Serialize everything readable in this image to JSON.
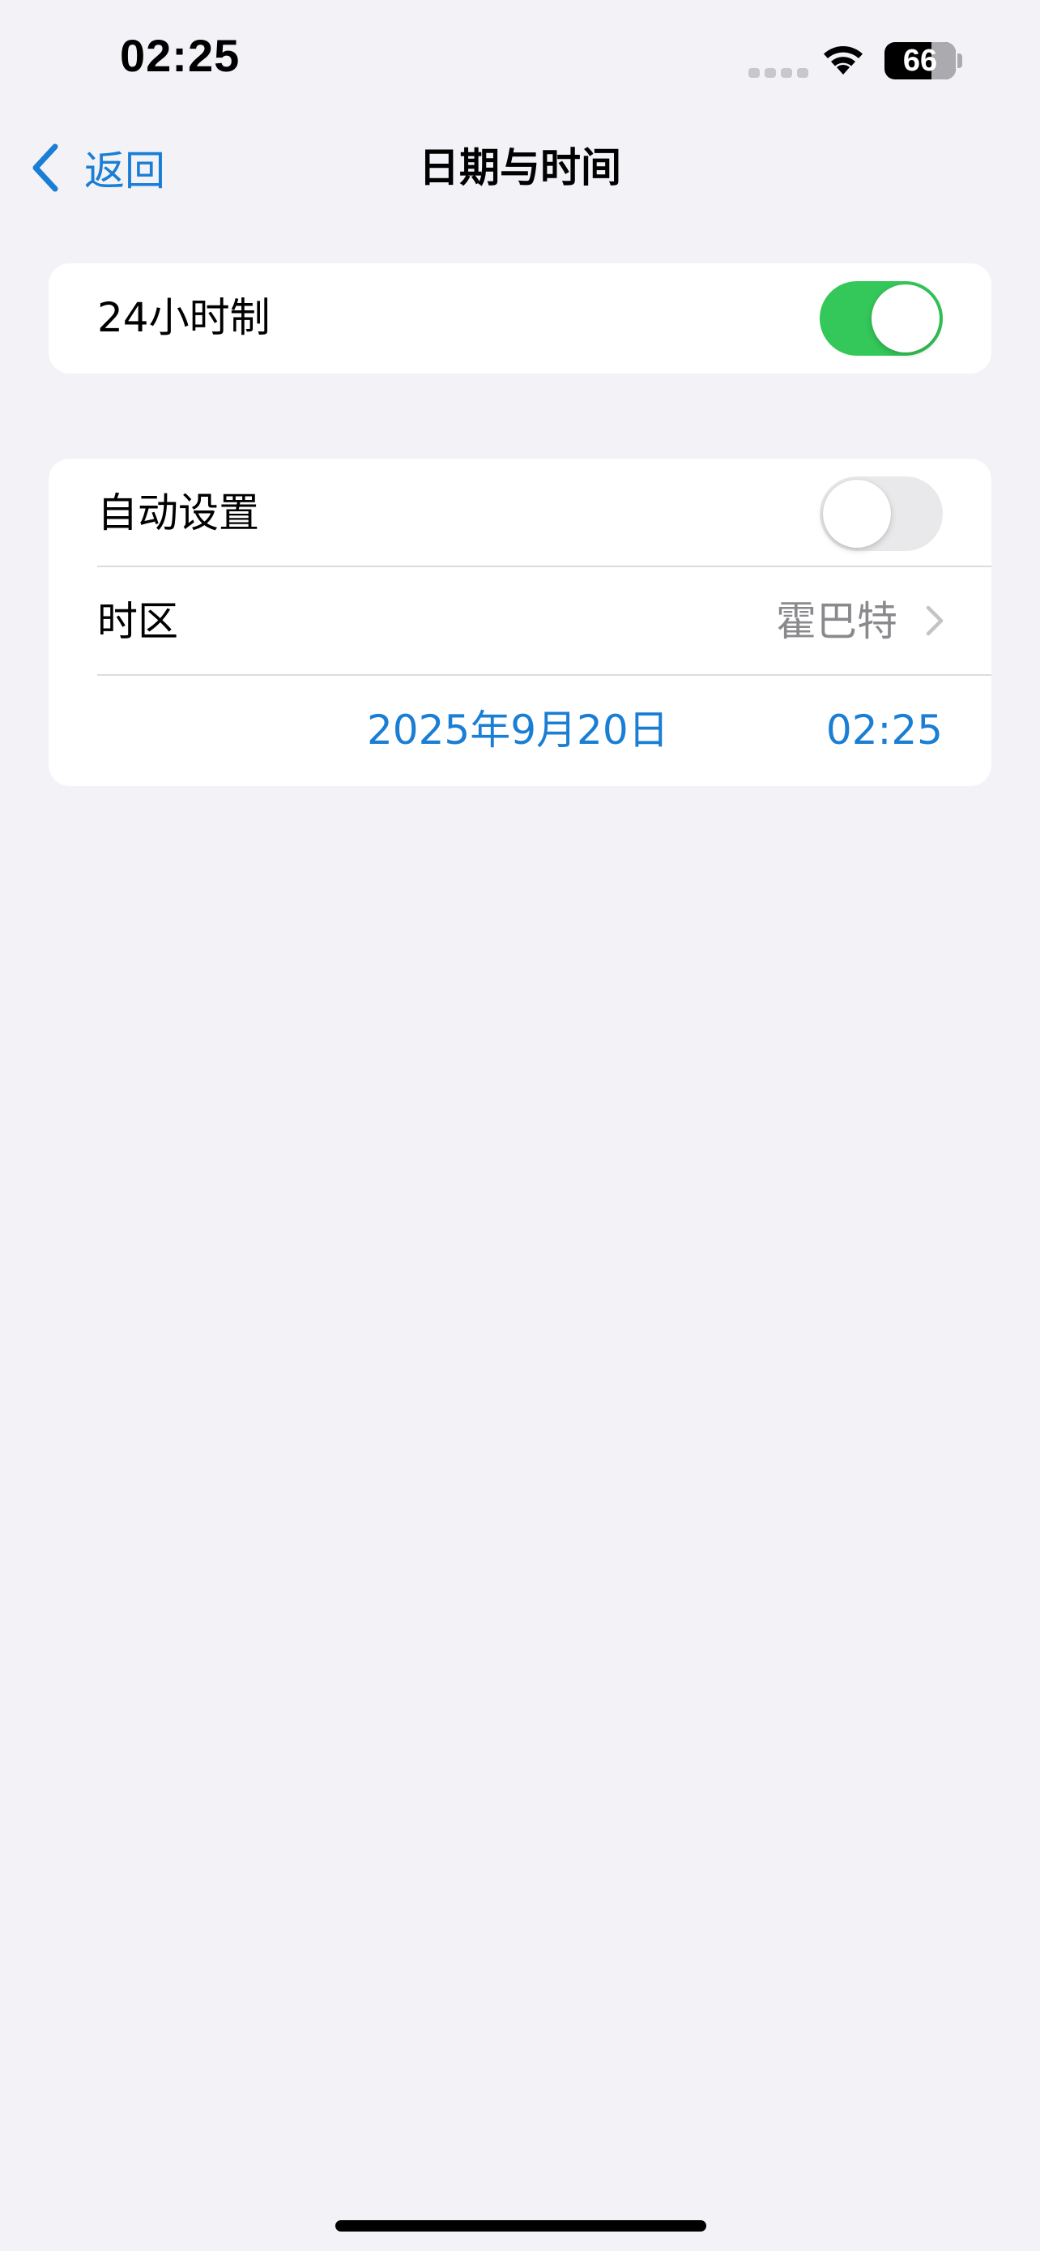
{
  "status_bar": {
    "time": "02:25",
    "battery_level": "66",
    "battery_percent": 66,
    "wifi_icon": "wifi-icon",
    "signal_icon": "no-signal-dots-icon"
  },
  "nav": {
    "back_label": "返回",
    "back_icon": "chevron-left-icon",
    "title": "日期与时间"
  },
  "settings": {
    "hour24": {
      "label": "24小时制",
      "enabled": true
    },
    "auto_set": {
      "label": "自动设置",
      "enabled": false
    },
    "timezone": {
      "label": "时区",
      "value": "霍巴特",
      "icon": "chevron-right-icon"
    },
    "datetime": {
      "date": "2025年9月20日",
      "time": "02:25"
    }
  },
  "colors": {
    "accent": "#1a7ed4",
    "toggle_on": "#34c759",
    "toggle_off": "#e9e9eb",
    "background": "#f2f2f7",
    "secondary_text": "#8a8a8e"
  }
}
